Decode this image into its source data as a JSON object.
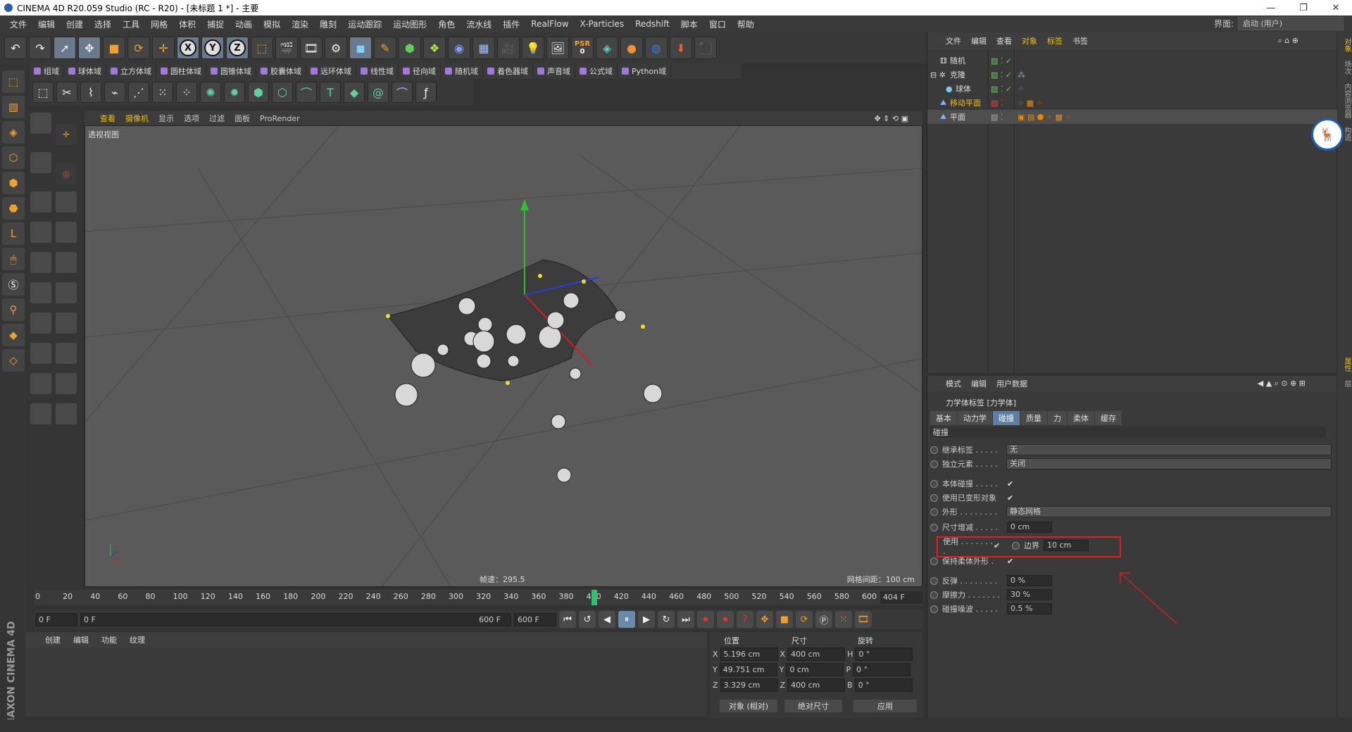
{
  "window": {
    "title": "CINEMA 4D R20.059 Studio (RC - R20) - [未标题 1 *] - 主要",
    "controls": [
      "—",
      "❐",
      "✕"
    ]
  },
  "menu": [
    "文件",
    "编辑",
    "创建",
    "选择",
    "工具",
    "网格",
    "体积",
    "捕捉",
    "动画",
    "模拟",
    "渲染",
    "雕刻",
    "运动跟踪",
    "运动图形",
    "角色",
    "流水线",
    "插件",
    "RealFlow",
    "X-Particles",
    "Redshift",
    "脚本",
    "窗口",
    "帮助"
  ],
  "interface": {
    "label": "界面:",
    "value": "启动 (用户)"
  },
  "toolbar1": {
    "axis_x": "X",
    "axis_y": "Y",
    "axis_z": "Z",
    "psr_label": "PSR",
    "psr_value": "0"
  },
  "fields_bar": [
    "组域",
    "球体域",
    "立方体域",
    "圆柱体域",
    "圆锥体域",
    "胶囊体域",
    "远环体域",
    "线性域",
    "径向域",
    "随机域",
    "着色器域",
    "声音域",
    "公式域",
    "Python域"
  ],
  "viewport": {
    "menu": [
      "查看",
      "摄像机",
      "显示",
      "选项",
      "过滤",
      "面板",
      "ProRender"
    ],
    "label": "透视视图",
    "fps": "帧速：295.5",
    "grid": "网格间距：100 cm"
  },
  "timeline": {
    "ticks": [
      "0",
      "20",
      "40",
      "60",
      "80",
      "100",
      "120",
      "140",
      "160",
      "180",
      "200",
      "220",
      "240",
      "260",
      "280",
      "300",
      "320",
      "340",
      "360",
      "380",
      "400",
      "420",
      "440",
      "460",
      "480",
      "500",
      "520",
      "540",
      "560",
      "580",
      "600"
    ],
    "current_frame": "404 F",
    "playhead_fraction": 0.673
  },
  "transport": {
    "start": "0 F",
    "range_start": "0 F",
    "range_end": "600 F",
    "end": "600 F"
  },
  "material": {
    "menu": [
      "创建",
      "编辑",
      "功能",
      "纹理"
    ]
  },
  "brand": "MAXON CINEMA 4D",
  "coords": {
    "headers": [
      "位置",
      "尺寸",
      "旋转"
    ],
    "rows": [
      {
        "a": "X",
        "pos": "5.196 cm",
        "b": "X",
        "size": "400 cm",
        "c": "H",
        "rot": "0 °"
      },
      {
        "a": "Y",
        "pos": "49.751 cm",
        "b": "Y",
        "size": "0 cm",
        "c": "P",
        "rot": "0 °"
      },
      {
        "a": "Z",
        "pos": "3.329 cm",
        "b": "Z",
        "size": "400 cm",
        "c": "B",
        "rot": "0 °"
      }
    ],
    "mode": "对象 (相对)",
    "size_mode": "绝对尺寸",
    "apply": "应用"
  },
  "objects": {
    "menu": [
      "文件",
      "编辑",
      "查看",
      "对象",
      "标签",
      "书签"
    ],
    "items": [
      {
        "name": "随机",
        "color": "#dddddd"
      },
      {
        "name": "克隆",
        "color": "#dddddd"
      },
      {
        "name": "球体",
        "color": "#dddddd"
      },
      {
        "name": "移动平面",
        "color": "#f0c000"
      },
      {
        "name": "平面",
        "color": "#dddddd"
      }
    ]
  },
  "attributes": {
    "menu": [
      "模式",
      "编辑",
      "用户数据"
    ],
    "title": "力学体标签 [力学体]",
    "tabs": [
      "基本",
      "动力学",
      "碰撞",
      "质量",
      "力",
      "柔体",
      "缓存"
    ],
    "active_tab": "碰撞",
    "section": "碰撞",
    "inherit_label": "继承标签 . . . . .",
    "inherit_value": "无",
    "independent_label": "独立元素 . . . . .",
    "independent_value": "关闭",
    "self_collision_label": "本体碰撞 . . . . .",
    "use_deformed_label": "使用已变形对象",
    "shape_label": "外形 . . . . . . . .",
    "shape_value": "静态网格",
    "size_inc_label": "尺寸增减 . . . . .",
    "size_inc_value": "0 cm",
    "use_label": "使用 . . . . . . . .",
    "margin_label": "边界",
    "margin_value": "10 cm",
    "keep_soft_label": "保持柔体外形 .",
    "bounce_label": "反弹 . . . . . . . .",
    "bounce_value": "0 %",
    "friction_label": "摩擦力 . . . . . . .",
    "friction_value": "30 %",
    "noise_label": "碰撞噪波 . . . . .",
    "noise_value": "0.5 %",
    "check": "✔"
  },
  "sidetabs": [
    "对象",
    "场次",
    "内容浏览器",
    "构造",
    "属性",
    "层"
  ]
}
